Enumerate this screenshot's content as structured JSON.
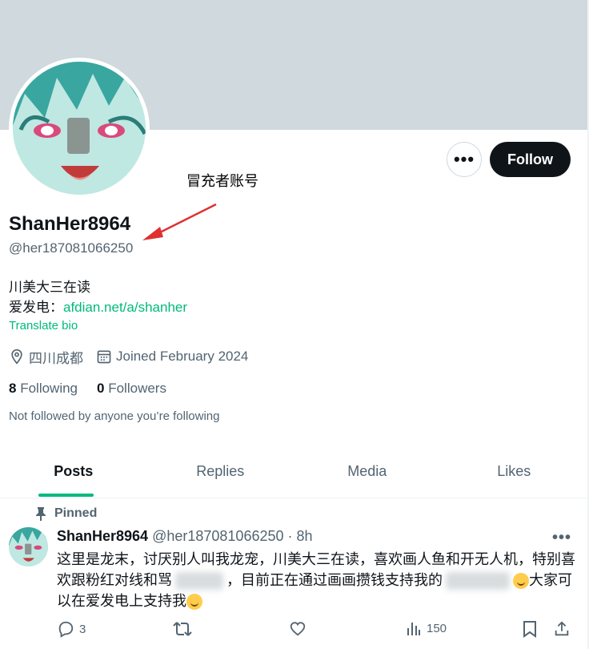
{
  "profile": {
    "display_name": "ShanHer8964",
    "handle": "@her187081066250",
    "bio_line1": "川美大三在读",
    "bio_prefix": "爱发电：",
    "bio_link": "afdian.net/a/shanher",
    "translate": "Translate bio",
    "location": "四川成都",
    "joined": "Joined February 2024",
    "following_count": "8",
    "following_label": "Following",
    "followers_count": "0",
    "followers_label": "Followers",
    "not_followed": "Not followed by anyone you’re following"
  },
  "buttons": {
    "follow": "Follow",
    "more": "•••"
  },
  "annotation": "冒充者账号",
  "tabs": [
    "Posts",
    "Replies",
    "Media",
    "Likes"
  ],
  "tweet": {
    "pinned": "Pinned",
    "name": "ShanHer8964",
    "meta": "@her187081066250 · 8h",
    "text_a": "这里是龙末，讨厌别人叫我龙宠，川美大三在读，喜欢画人鱼和开无人机，特别喜欢跟粉红对线和骂",
    "text_b": "，目前正在通过画画攒钱支持我的",
    "text_c": "大家可以在爱发电上支持我",
    "replies": "3",
    "views": "150"
  },
  "colors": {
    "accent": "#00ba7c",
    "follow_bg": "#0f1419",
    "banner": "#cfd9de",
    "secondary_text": "#536471"
  }
}
